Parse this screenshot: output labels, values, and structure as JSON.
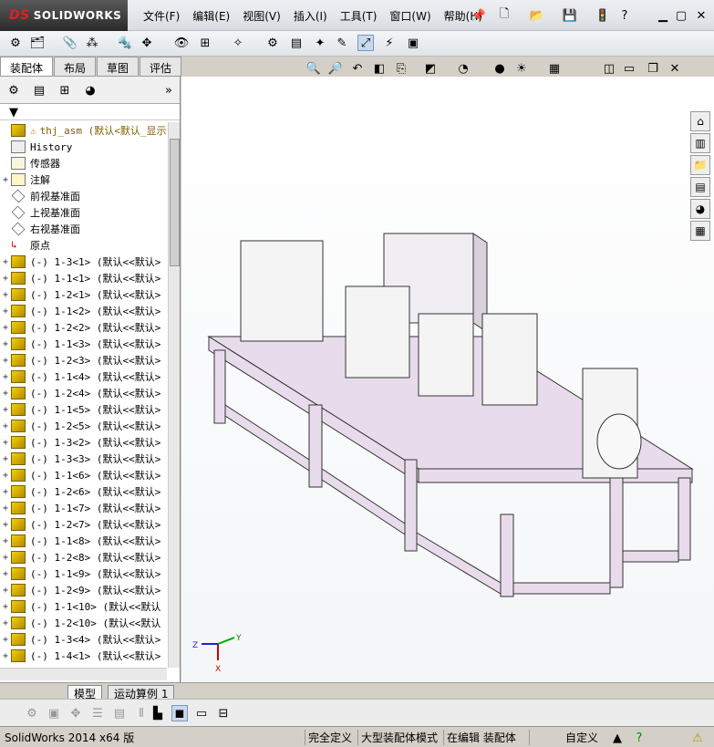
{
  "app": {
    "logo_text": "SOLIDWORKS",
    "logo_prefix": "DS"
  },
  "menu": [
    "文件(F)",
    "编辑(E)",
    "视图(V)",
    "插入(I)",
    "工具(T)",
    "窗口(W)",
    "帮助(H)"
  ],
  "tabs": [
    {
      "label": "装配体",
      "active": true
    },
    {
      "label": "布局",
      "active": false
    },
    {
      "label": "草图",
      "active": false
    },
    {
      "label": "评估",
      "active": false
    }
  ],
  "tree": {
    "root": "thj_asm  (默认<默认_显示",
    "fixed_items": [
      "History",
      "传感器",
      "注解",
      "前视基准面",
      "上视基准面",
      "右视基准面",
      "原点"
    ],
    "components": [
      "(-) 1-3<1> (默认<<默认>",
      "(-) 1-1<1> (默认<<默认>",
      "(-) 1-2<1> (默认<<默认>",
      "(-) 1-1<2> (默认<<默认>",
      "(-) 1-2<2> (默认<<默认>",
      "(-) 1-1<3> (默认<<默认>",
      "(-) 1-2<3> (默认<<默认>",
      "(-) 1-1<4> (默认<<默认>",
      "(-) 1-2<4> (默认<<默认>",
      "(-) 1-1<5> (默认<<默认>",
      "(-) 1-2<5> (默认<<默认>",
      "(-) 1-3<2> (默认<<默认>",
      "(-) 1-3<3> (默认<<默认>",
      "(-) 1-1<6> (默认<<默认>",
      "(-) 1-2<6> (默认<<默认>",
      "(-) 1-1<7> (默认<<默认>",
      "(-) 1-2<7> (默认<<默认>",
      "(-) 1-1<8> (默认<<默认>",
      "(-) 1-2<8> (默认<<默认>",
      "(-) 1-1<9> (默认<<默认>",
      "(-) 1-2<9> (默认<<默认>",
      "(-) 1-1<10> (默认<<默认",
      "(-) 1-2<10> (默认<<默认",
      "(-) 1-3<4> (默认<<默认>",
      "(-) 1-4<1> (默认<<默认>"
    ]
  },
  "bottom_tabs": [
    {
      "label": "模型",
      "active": true
    },
    {
      "label": "运动算例 1",
      "active": false
    }
  ],
  "status": {
    "version": "SolidWorks 2014 x64 版",
    "defined": "完全定义",
    "mode": "大型装配体模式",
    "editing": "在编辑 装配体",
    "custom": "自定义"
  },
  "axes": {
    "x": "X",
    "y": "Y",
    "z": "Z"
  },
  "colors": {
    "frame_fill": "#e8dcec",
    "frame_stroke": "#333333",
    "viewport_bg": "#ffffff"
  }
}
